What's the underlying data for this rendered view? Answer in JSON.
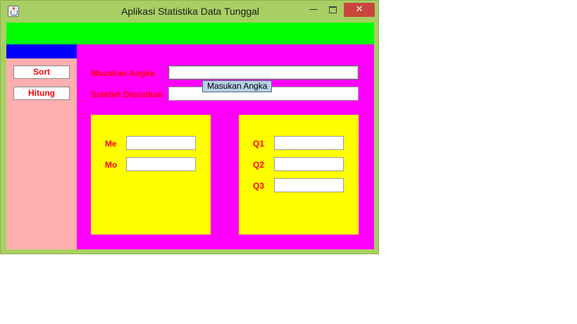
{
  "window": {
    "title": "Aplikasi Statistika Data Tunggal",
    "minimize": "—",
    "close": "✕"
  },
  "sidebar": {
    "sort_label": "Sort",
    "hitung_label": "Hitung"
  },
  "form": {
    "input_label": "Masukan Angka",
    "input_value": "",
    "sorted_label": "Setelah Diurutkan",
    "sorted_value": "",
    "tooltip": "Masukan Angka"
  },
  "central": {
    "me_label": "Me",
    "me_value": "",
    "mo_label": "Mo",
    "mo_value": ""
  },
  "quartiles": {
    "q1_label": "Q1",
    "q1_value": "",
    "q2_label": "Q2",
    "q2_value": "",
    "q3_label": "Q3",
    "q3_value": ""
  },
  "colors": {
    "header": "#00ff00",
    "sidebar": "#ffafaf",
    "sidebar_header": "#0000ff",
    "main": "#ff00ff",
    "panel": "#ffff00",
    "label_text": "#ff0000"
  }
}
